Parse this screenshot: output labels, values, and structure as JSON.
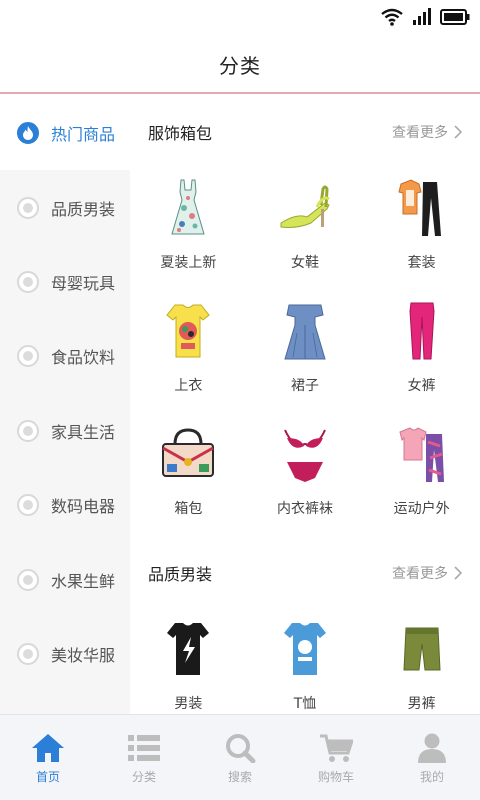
{
  "header": {
    "title": "分类"
  },
  "sidebar": {
    "items": [
      {
        "label": "热门商品",
        "icon": "flame-icon",
        "active": true
      },
      {
        "label": "品质男装",
        "icon": "shirt-icon"
      },
      {
        "label": "母婴玩具",
        "icon": "toy-icon"
      },
      {
        "label": "食品饮料",
        "icon": "food-icon"
      },
      {
        "label": "家具生活",
        "icon": "furniture-icon"
      },
      {
        "label": "数码电器",
        "icon": "device-icon"
      },
      {
        "label": "水果生鲜",
        "icon": "fruit-icon"
      },
      {
        "label": "美妆华服",
        "icon": "makeup-icon"
      }
    ]
  },
  "sections": [
    {
      "title": "服饰箱包",
      "more": "查看更多",
      "items": [
        {
          "label": "夏装上新",
          "icon": "floral-dress-icon"
        },
        {
          "label": "女鞋",
          "icon": "heel-sandal-icon"
        },
        {
          "label": "套装",
          "icon": "outfit-icon"
        },
        {
          "label": "上衣",
          "icon": "tshirt-yellow-icon"
        },
        {
          "label": "裙子",
          "icon": "denim-dress-icon"
        },
        {
          "label": "女裤",
          "icon": "pink-pants-icon"
        },
        {
          "label": "箱包",
          "icon": "handbag-icon"
        },
        {
          "label": "内衣裤袜",
          "icon": "lingerie-icon"
        },
        {
          "label": "运动户外",
          "icon": "sportswear-icon"
        }
      ]
    },
    {
      "title": "品质男装",
      "more": "查看更多",
      "items": [
        {
          "label": "男装",
          "icon": "black-tshirt-icon"
        },
        {
          "label": "T恤",
          "icon": "blue-tshirt-icon"
        },
        {
          "label": "男裤",
          "icon": "shorts-icon"
        }
      ]
    }
  ],
  "tabbar": {
    "items": [
      {
        "label": "首页",
        "icon": "home-icon",
        "active": true
      },
      {
        "label": "分类",
        "icon": "list-icon"
      },
      {
        "label": "搜索",
        "icon": "search-icon"
      },
      {
        "label": "购物车",
        "icon": "cart-icon"
      },
      {
        "label": "我的",
        "icon": "user-icon"
      }
    ]
  },
  "colors": {
    "accent": "#2b7fd6",
    "header_border": "#e6a9b4",
    "sidebar_bg": "#f6f6f6"
  }
}
